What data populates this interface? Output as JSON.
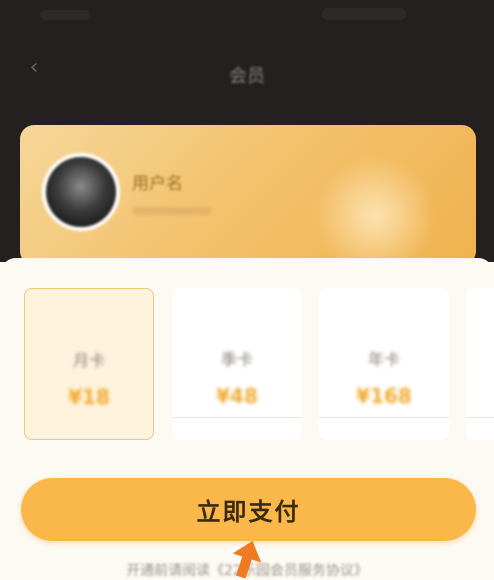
{
  "header": {
    "back_icon": "chevron-left-icon",
    "title": "会员"
  },
  "member_card": {
    "username": "用户名",
    "avatar": "avatar-image"
  },
  "plans": [
    {
      "name": "月卡",
      "price": "¥18",
      "selected": true
    },
    {
      "name": "季卡",
      "price": "¥48",
      "selected": false
    },
    {
      "name": "年卡",
      "price": "¥168",
      "selected": false
    }
  ],
  "pay_button": {
    "label": "立即支付"
  },
  "agreement_text": "开通前请阅读《22乐园会员服务协议》",
  "colors": {
    "dark_header": "#23201f",
    "gold_card": "#f3c36e",
    "accent_orange": "#fbb84a",
    "arrow": "#f07a22"
  },
  "annotation": {
    "arrow_icon": "arrow-up-icon"
  }
}
